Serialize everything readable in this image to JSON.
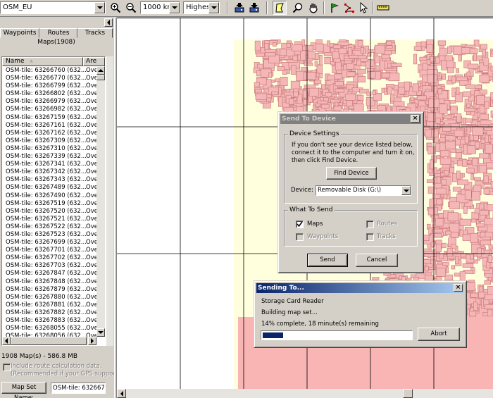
{
  "toolbar": {
    "map_product": "OSM_EU",
    "zoom_scale": "1000 km",
    "detail_level": "Highest"
  },
  "tabs": [
    "Waypoints",
    "Routes",
    "Tracks"
  ],
  "maps_header": "Maps(1908)",
  "columns": [
    "Name",
    "Are"
  ],
  "maps": [
    "OSM-tile: 63266760 (632...",
    "OSM-tile: 63266770 (632...",
    "OSM-tile: 63266799 (632...",
    "OSM-tile: 63266802 (632...",
    "OSM-tile: 63266979 (632...",
    "OSM-tile: 63266982 (632...",
    "OSM-tile: 63267159 (632...",
    "OSM-tile: 63267161 (632...",
    "OSM-tile: 63267162 (632...",
    "OSM-tile: 63267309 (632...",
    "OSM-tile: 63267310 (632...",
    "OSM-tile: 63267339 (632...",
    "OSM-tile: 63267341 (632...",
    "OSM-tile: 63267342 (632...",
    "OSM-tile: 63267343 (632...",
    "OSM-tile: 63267489 (632...",
    "OSM-tile: 63267490 (632...",
    "OSM-tile: 63267519 (632...",
    "OSM-tile: 63267520 (632...",
    "OSM-tile: 63267521 (632...",
    "OSM-tile: 63267522 (632...",
    "OSM-tile: 63267523 (632...",
    "OSM-tile: 63267699 (632...",
    "OSM-tile: 63267701 (632...",
    "OSM-tile: 63267702 (632...",
    "OSM-tile: 63267703 (632...",
    "OSM-tile: 63267847 (632...",
    "OSM-tile: 63267848 (632...",
    "OSM-tile: 63267879 (632...",
    "OSM-tile: 63267880 (632...",
    "OSM-tile: 63267881 (632...",
    "OSM-tile: 63267882 (632...",
    "OSM-tile: 63267883 (632...",
    "OSM-tile: 63268055 (632...",
    "OSM-tile: 63268056 (632..."
  ],
  "area_value": "Ove",
  "summary": "1908 Map(s) - 586.8 MB",
  "include_route_line1": "Include route calculation data.",
  "include_route_line2": "(Recommended if your GPS supports...",
  "map_set_name_label": "Map Set Name:",
  "map_set_name_value": "OSM-tile: 63266760",
  "send_dialog": {
    "title": "Send To Device",
    "device_settings_label": "Device Settings",
    "help_text": "If you don't see your device listed below, connect it to the computer and turn it on, then click Find Device.",
    "find_device": "Find Device",
    "device_label": "Device:",
    "device_value": "Removable Disk (G:\\)",
    "what_to_send_label": "What To Send",
    "maps": "Maps",
    "waypoints": "Waypoints",
    "routes": "Routes",
    "tracks": "Tracks",
    "send": "Send",
    "cancel": "Cancel"
  },
  "progress_dialog": {
    "title": "Sending To...",
    "target": "Storage Card Reader",
    "status": "Building map set...",
    "progress_text": "14% complete, 18 minute(s) remaining",
    "progress": 0.14,
    "abort": "Abort"
  },
  "colors": {
    "map_bg": "#ffffde",
    "tile_fill": "#f4b6b6",
    "tile_stroke": "#c47474",
    "coverage": "#f9b4b4",
    "titlebar_active": "#0a246a",
    "progress": "#0a246a"
  }
}
